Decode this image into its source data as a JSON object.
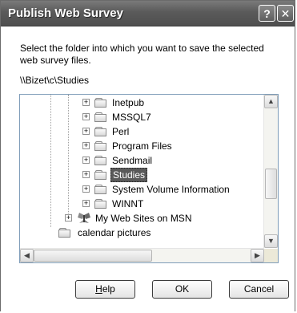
{
  "window": {
    "title": "Publish Web Survey"
  },
  "titlebar_buttons": {
    "help": "?",
    "close": "✕"
  },
  "instruction": "Select the folder into which you want to save the selected web survey files.",
  "current_path": "\\\\Bizet\\c\\Studies",
  "tree": {
    "items": [
      {
        "label": "Inetpub",
        "selected": false,
        "expander": "+"
      },
      {
        "label": "MSSQL7",
        "selected": false,
        "expander": "+"
      },
      {
        "label": "Perl",
        "selected": false,
        "expander": "+"
      },
      {
        "label": "Program Files",
        "selected": false,
        "expander": "+"
      },
      {
        "label": "Sendmail",
        "selected": false,
        "expander": "+"
      },
      {
        "label": "Studies",
        "selected": true,
        "expander": "+"
      },
      {
        "label": "System Volume Information",
        "selected": false,
        "expander": "+"
      },
      {
        "label": "WINNT",
        "selected": false,
        "expander": "+"
      },
      {
        "label": "My Web Sites on MSN",
        "selected": false,
        "expander": "+"
      },
      {
        "label": "calendar pictures",
        "selected": false,
        "expander": ""
      }
    ]
  },
  "scroll_glyphs": {
    "up": "▲",
    "down": "▼",
    "left": "◀",
    "right": "▶"
  },
  "buttons": {
    "help_mnemonic": "H",
    "help_rest": "elp",
    "ok": "OK",
    "cancel": "Cancel"
  },
  "colors": {
    "selection": "#5a5a5a",
    "titlebar": "#5a5a5a",
    "tree_border": "#7f9db9"
  }
}
